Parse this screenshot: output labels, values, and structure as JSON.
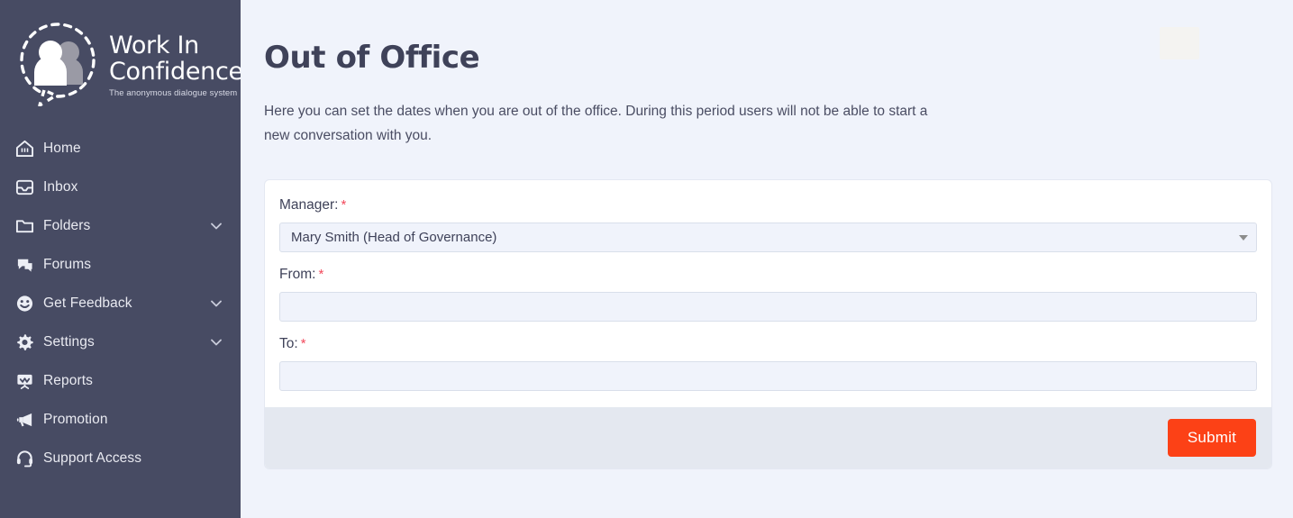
{
  "brand": {
    "name_line1": "Work In",
    "name_line2": "Confidence",
    "tagline": "The anonymous dialogue system",
    "logo_icon": "two-people-in-dashed-speech-bubble-icon"
  },
  "colors": {
    "sidebar_bg": "#474b63",
    "page_bg": "#f0f3fb",
    "card_bg": "#ffffff",
    "card_footer_bg": "#e4e8f0",
    "submit_bg": "#fc4116",
    "required_asterisk": "#f2495c",
    "input_bg": "#f0f3fb",
    "input_border": "#d9dfea",
    "heading_text": "#3f4259"
  },
  "sidebar": {
    "items": [
      {
        "label": "Home",
        "icon": "home-icon",
        "expandable": false
      },
      {
        "label": "Inbox",
        "icon": "inbox-icon",
        "expandable": false
      },
      {
        "label": "Folders",
        "icon": "folder-icon",
        "expandable": true
      },
      {
        "label": "Forums",
        "icon": "forums-chat-icon",
        "expandable": false
      },
      {
        "label": "Get Feedback",
        "icon": "smiley-face-icon",
        "expandable": true
      },
      {
        "label": "Settings",
        "icon": "gear-icon",
        "expandable": true
      },
      {
        "label": "Reports",
        "icon": "presentation-chart-icon",
        "expandable": false
      },
      {
        "label": "Promotion",
        "icon": "megaphone-icon",
        "expandable": false
      },
      {
        "label": "Support Access",
        "icon": "headset-icon",
        "expandable": false
      }
    ],
    "chevron_icon": "chevron-down-icon"
  },
  "page": {
    "title": "Out of Office",
    "description": "Here you can set the dates when you are out of the office. During this period users will not be able to start a new conversation with you."
  },
  "form": {
    "fields": [
      {
        "label": "Manager:",
        "required_mark": "*",
        "type": "select",
        "value": "Mary Smith (Head of Governance)",
        "placeholder": "",
        "caret_icon": "caret-down-icon"
      },
      {
        "label": "From:",
        "required_mark": "*",
        "type": "text",
        "value": "",
        "placeholder": ""
      },
      {
        "label": "To:",
        "required_mark": "*",
        "type": "text",
        "value": "",
        "placeholder": ""
      }
    ],
    "submit_label": "Submit"
  }
}
